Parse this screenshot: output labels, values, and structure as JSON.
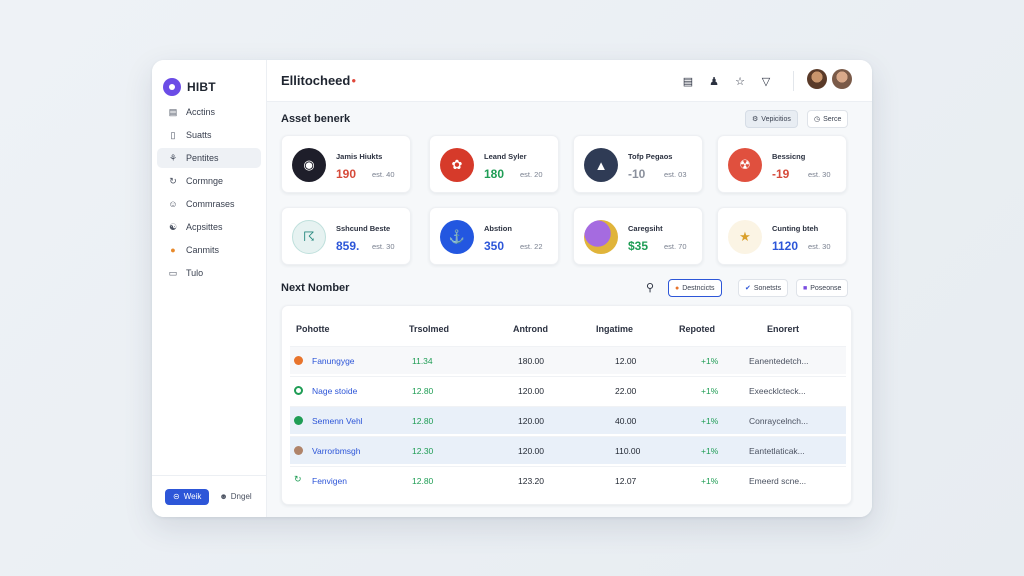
{
  "app": {
    "brand": "HIBT",
    "page_title": "Ellitocheed",
    "accent": "#2d56d8"
  },
  "sidebar": {
    "items": [
      {
        "label": "Acctins",
        "icon": "wallet-icon"
      },
      {
        "label": "Suatts",
        "icon": "document-icon"
      },
      {
        "label": "Pentites",
        "icon": "activity-icon",
        "active": true
      },
      {
        "label": "Cormnge",
        "icon": "refresh-icon"
      },
      {
        "label": "Commrases",
        "icon": "user-icon"
      },
      {
        "label": "Acpsittes",
        "icon": "users-icon"
      },
      {
        "label": "Canmits",
        "icon": "coin-icon"
      },
      {
        "label": "Tulo",
        "icon": "terminal-icon"
      }
    ],
    "primary_button": "Weik",
    "secondary_button": "Dngel"
  },
  "asset_section": {
    "title": "Asset benerk",
    "btn_a": "Vepicitios",
    "btn_b": "Serce",
    "cards": [
      {
        "name": "Jamis Hiukts",
        "value": "190",
        "sub": "est. 40",
        "color": "#d64a3a"
      },
      {
        "name": "Leand Syler",
        "value": "180",
        "sub": "est. 20",
        "color": "#1f9d55"
      },
      {
        "name": "Tofp Pegaos",
        "value": "-10",
        "sub": "est. 03",
        "color": "#8a909c"
      },
      {
        "name": "Bessicng",
        "value": "-19",
        "sub": "est. 30",
        "color": "#d64a3a"
      },
      {
        "name": "Sshcund Beste",
        "value": "859.",
        "sub": "est. 30",
        "color": "#2d56d8"
      },
      {
        "name": "Abstion",
        "value": "350",
        "sub": "est. 22",
        "color": "#2d56d8"
      },
      {
        "name": "Caregsiht",
        "value": "$35",
        "sub": "est. 70",
        "color": "#1f9d55"
      },
      {
        "name": "Cunting bteh",
        "value": "1120",
        "sub": "est. 30",
        "color": "#2d56d8"
      }
    ]
  },
  "table_section": {
    "title": "Next Nomber",
    "filters": [
      "Destncicts",
      "Sonetsts",
      "Poseonse"
    ],
    "columns": [
      "Pohotte",
      "Trsolmed",
      "Antrond",
      "Ingatime",
      "Repoted",
      "Enorert"
    ],
    "rows": [
      {
        "name": "Fanungyge",
        "c1": "11.34",
        "c2": "180.00",
        "c3": "12.00",
        "c4": "+1%",
        "c5": "Eanentedetch...",
        "dot": "#e8742c"
      },
      {
        "name": "Nage stoide",
        "c1": "12.80",
        "c2": "120.00",
        "c3": "22.00",
        "c4": "+1%",
        "c5": "Exeecklcteck...",
        "dot": "#1f9d55"
      },
      {
        "name": "Semenn Vehl",
        "c1": "12.80",
        "c2": "120.00",
        "c3": "40.00",
        "c4": "+1%",
        "c5": "Conraycelnch...",
        "dot": "#1f9d55"
      },
      {
        "name": "Varrorbmsgh",
        "c1": "12.30",
        "c2": "120.00",
        "c3": "110.00",
        "c4": "+1%",
        "c5": "Eantetlaticak...",
        "dot": "#b0846a"
      },
      {
        "name": "Fenvigen",
        "c1": "12.80",
        "c2": "123.20",
        "c3": "12.07",
        "c4": "+1%",
        "c5": "Emeerd scne...",
        "dot": "#1f9d55"
      }
    ]
  }
}
